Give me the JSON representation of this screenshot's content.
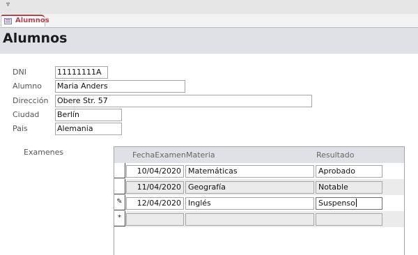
{
  "topbar": {
    "icon": "chevron-down-icon",
    "glyph": "▿"
  },
  "tab": {
    "label": "Alumnos",
    "icon": "form-icon"
  },
  "header": {
    "title": "Alumnos"
  },
  "form": {
    "dni": {
      "label": "DNI",
      "value": "11111111A"
    },
    "alumno": {
      "label": "Alumno",
      "value": "Maria Anders"
    },
    "direccion": {
      "label": "Dirección",
      "value": "Obere Str. 57"
    },
    "ciudad": {
      "label": "Ciudad",
      "value": "Berlín"
    },
    "pais": {
      "label": "Pais",
      "value": "Alemania"
    }
  },
  "subform": {
    "label": "Examenes",
    "columns": [
      "FechaExamen",
      "Materia",
      "Resultado"
    ],
    "rows": [
      {
        "fecha": "10/04/2020",
        "materia": "Matemáticas",
        "resultado": "Aprobado",
        "selector": ""
      },
      {
        "fecha": "11/04/2020",
        "materia": "Geografía",
        "resultado": "Notable",
        "selector": ""
      },
      {
        "fecha": "12/04/2020",
        "materia": "Inglés",
        "resultado": "Suspenso",
        "selector": "✎"
      }
    ],
    "new_row": {
      "selector": "*"
    }
  }
}
